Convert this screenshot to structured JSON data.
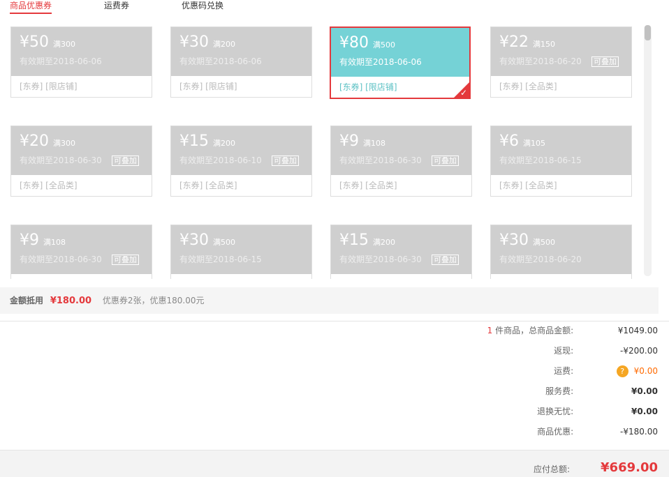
{
  "tabs": [
    "商品优惠券",
    "运费券",
    "优惠码兑换"
  ],
  "coupons": [
    {
      "amount": "¥50",
      "quota": "满300",
      "expiry": "有效期至2018-06-06",
      "tags": "[东券] [限店铺]",
      "stackable": ""
    },
    {
      "amount": "¥30",
      "quota": "满200",
      "expiry": "有效期至2018-06-06",
      "tags": "[东券] [限店铺]",
      "stackable": ""
    },
    {
      "amount": "¥80",
      "quota": "满500",
      "expiry": "有效期至2018-06-06",
      "tags": "[东券] [限店铺]",
      "stackable": "",
      "selected": true
    },
    {
      "amount": "¥22",
      "quota": "满150",
      "expiry": "有效期至2018-06-20",
      "tags": "[东券] [全品类]",
      "stackable": "可叠加"
    },
    {
      "amount": "¥20",
      "quota": "满300",
      "expiry": "有效期至2018-06-30",
      "tags": "[东券] [全品类]",
      "stackable": "可叠加"
    },
    {
      "amount": "¥15",
      "quota": "满200",
      "expiry": "有效期至2018-06-10",
      "tags": "[东券] [全品类]",
      "stackable": "可叠加"
    },
    {
      "amount": "¥9",
      "quota": "满108",
      "expiry": "有效期至2018-06-30",
      "tags": "[东券] [全品类]",
      "stackable": "可叠加"
    },
    {
      "amount": "¥6",
      "quota": "满105",
      "expiry": "有效期至2018-06-15",
      "tags": "[东券] [全品类]",
      "stackable": ""
    },
    {
      "amount": "¥9",
      "quota": "满108",
      "expiry": "有效期至2018-06-30",
      "tags": "",
      "stackable": "可叠加"
    },
    {
      "amount": "¥30",
      "quota": "满500",
      "expiry": "有效期至2018-06-15",
      "tags": "",
      "stackable": ""
    },
    {
      "amount": "¥15",
      "quota": "满200",
      "expiry": "有效期至2018-06-30",
      "tags": "",
      "stackable": "可叠加"
    },
    {
      "amount": "¥30",
      "quota": "满500",
      "expiry": "有效期至2018-06-20",
      "tags": "",
      "stackable": ""
    }
  ],
  "summary": {
    "label": "金额抵用",
    "amount": "¥180.00",
    "desc": "优惠券2张，优惠180.00元"
  },
  "prices": {
    "item_count": "1",
    "total_label": "件商品，总商品金额:",
    "total": "¥1049.00",
    "cashback_label": "返现:",
    "cashback": "-¥200.00",
    "shipping_label": "运费:",
    "shipping": "¥0.00",
    "service_label": "服务费:",
    "service": "¥0.00",
    "return_label": "退换无忧:",
    "return": "¥0.00",
    "discount_label": "商品优惠:",
    "discount": "-¥180.00"
  },
  "total": {
    "label": "应付总额:",
    "value": "¥669.00"
  },
  "colors": {
    "accent": "#e4393c",
    "selected_coupon": "#75d2d6",
    "inactive_coupon": "#cfcfcf"
  }
}
